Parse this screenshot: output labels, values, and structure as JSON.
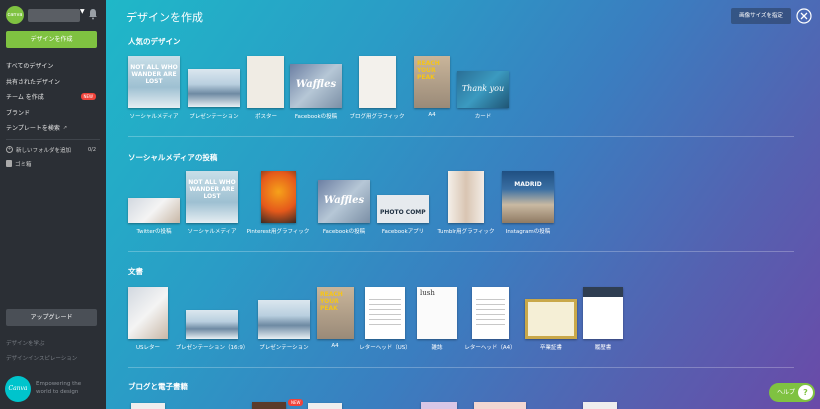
{
  "sidebar": {
    "avatar_text": "canva",
    "create_button": "デザインを作成",
    "nav": [
      {
        "label": "すべてのデザイン"
      },
      {
        "label": "共有されたデザイン"
      },
      {
        "label": "チーム を作成",
        "badge": "NEW"
      },
      {
        "label": "ブランド"
      },
      {
        "label": "テンプレートを検索"
      }
    ],
    "add_folder": "新しいフォルダを追加",
    "folder_count": "0/2",
    "trash": "ゴミ箱",
    "upgrade_button": "アップグレード",
    "learn_link": "デザインを学ぶ",
    "inspiration_link": "デザインインスピレーション",
    "logo_text": "Canva",
    "tagline": "Empowering the world to design"
  },
  "main": {
    "title": "デザインを作成",
    "custom_size_button": "画像サイズを指定",
    "help_button": "ヘルプ",
    "help_icon": "?",
    "sections": [
      {
        "title": "人気のデザイン",
        "items": [
          "ソーシャルメディア",
          "プレゼンテーション",
          "ポスター",
          "Facebookの投稿",
          "ブログ用グラフィック",
          "A4",
          "カード"
        ]
      },
      {
        "title": "ソーシャルメディアの投稿",
        "items": [
          "Twitterの投稿",
          "ソーシャルメディア",
          "Pinterest用グラフィック",
          "Facebookの投稿",
          "Facebookアプリ",
          "Tumblr用グラフィック",
          "Instagramの投稿"
        ]
      },
      {
        "title": "文書",
        "items": [
          "USレター",
          "プレゼンテーション（16:9）",
          "プレゼンテーション",
          "A4",
          "レターヘッド（US）",
          "雑誌",
          "レターヘッド（A4）",
          "卒業証書",
          "履歴書"
        ]
      },
      {
        "title": "ブログと電子書籍",
        "items": []
      }
    ],
    "thumb_text": {
      "lost": "NOT ALL WHO WANDER ARE LOST",
      "waffles": "Waffles",
      "reach": "REACH YOUR PEAK",
      "thankyou": "Thank you",
      "photo": "PHOTO COMP",
      "madrid": "MADRID",
      "lush": "lush",
      "new_badge": "NEW"
    }
  }
}
